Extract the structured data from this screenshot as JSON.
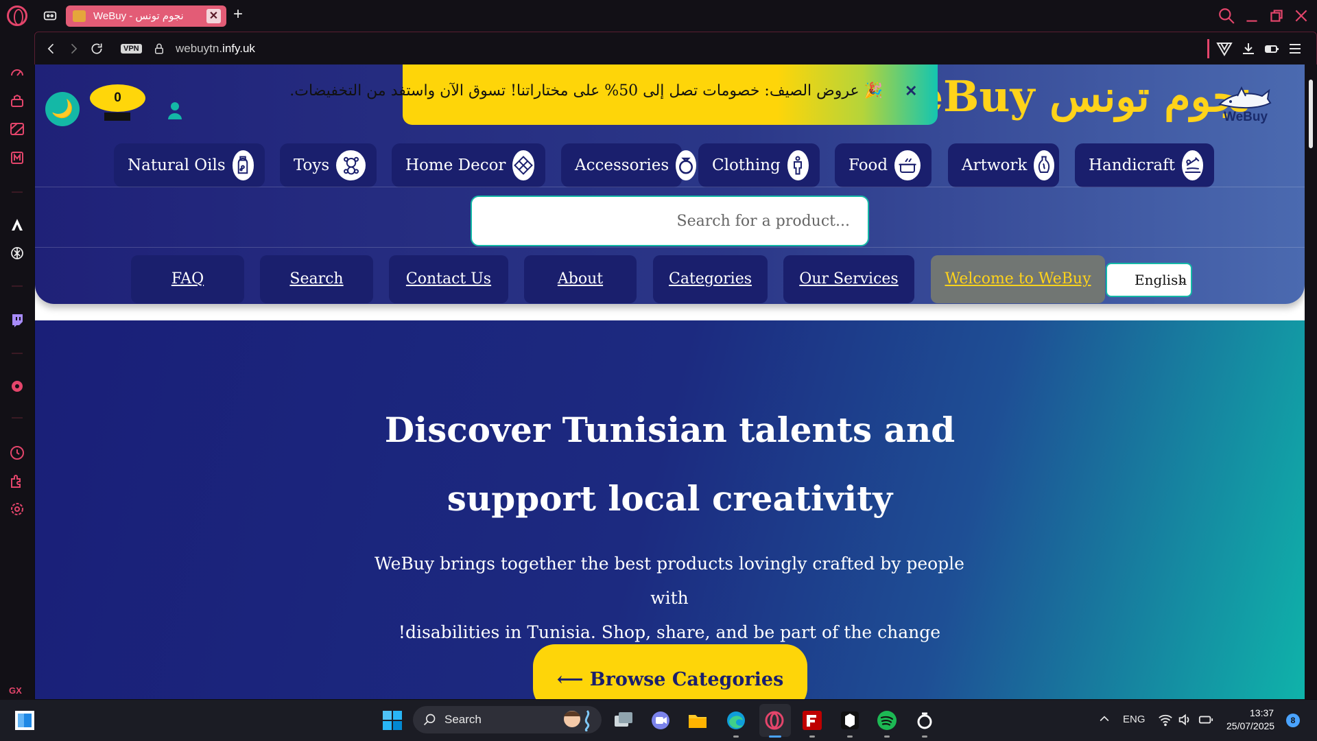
{
  "browser": {
    "tab_title": "WeBuy - نجوم تونس",
    "url_prefix": "webuytn.",
    "url_domain": "infy.uk",
    "vpn_label": "VPN",
    "new_tab_symbol": "+",
    "close_symbol": "✕",
    "gx_label": "GX",
    "more_label": "•••"
  },
  "header": {
    "cart_count": "0",
    "theme_icon": "🌙",
    "logo_text": "WeBuy نجوم تونس",
    "shark_logo_word": "WeBuy",
    "promo_text": "🎉 عروض الصيف: خصومات تصل إلى 50% على مختاراتنا! تسوق الآن واستفد من التخفيضات.",
    "promo_close": "✕",
    "categories": [
      {
        "label": "Natural Oils",
        "icon": "oil-bottle-icon"
      },
      {
        "label": "Toys",
        "icon": "teddy-bear-icon"
      },
      {
        "label": "Home Decor",
        "icon": "home-decor-icon"
      },
      {
        "label": "Accessories",
        "icon": "ring-icon"
      },
      {
        "label": "Clothing",
        "icon": "person-icon"
      },
      {
        "label": "Food",
        "icon": "cooking-pot-icon"
      },
      {
        "label": "Artwork",
        "icon": "vase-icon"
      },
      {
        "label": "Handicraft",
        "icon": "sewing-icon"
      }
    ],
    "search_placeholder": "...Search for a product",
    "nav": {
      "faq": "FAQ",
      "search": "Search",
      "contact": "Contact Us",
      "about": "About",
      "categories": "Categories",
      "services": "Our Services",
      "welcome": "Welcome to WeBuy"
    },
    "language": "English",
    "language_caret": "⌄"
  },
  "hero": {
    "title_line1": "Discover Tunisian talents and",
    "title_line2": "support local creativity",
    "subtitle_line1": "WeBuy brings together the best products lovingly crafted by people with",
    "subtitle_line2": "!disabilities in Tunisia. Shop, share, and be part of the change",
    "browse_label": "⟵ Browse Categories"
  },
  "taskbar": {
    "search_label": "Search",
    "language": "ENG",
    "time": "13:37",
    "date": "25/07/2025",
    "notification_count": "8"
  },
  "colors": {
    "accent_yellow": "#fed509",
    "teal": "#14b8a6",
    "navy": "#1a1f6d",
    "opera_red": "#e4456b"
  }
}
